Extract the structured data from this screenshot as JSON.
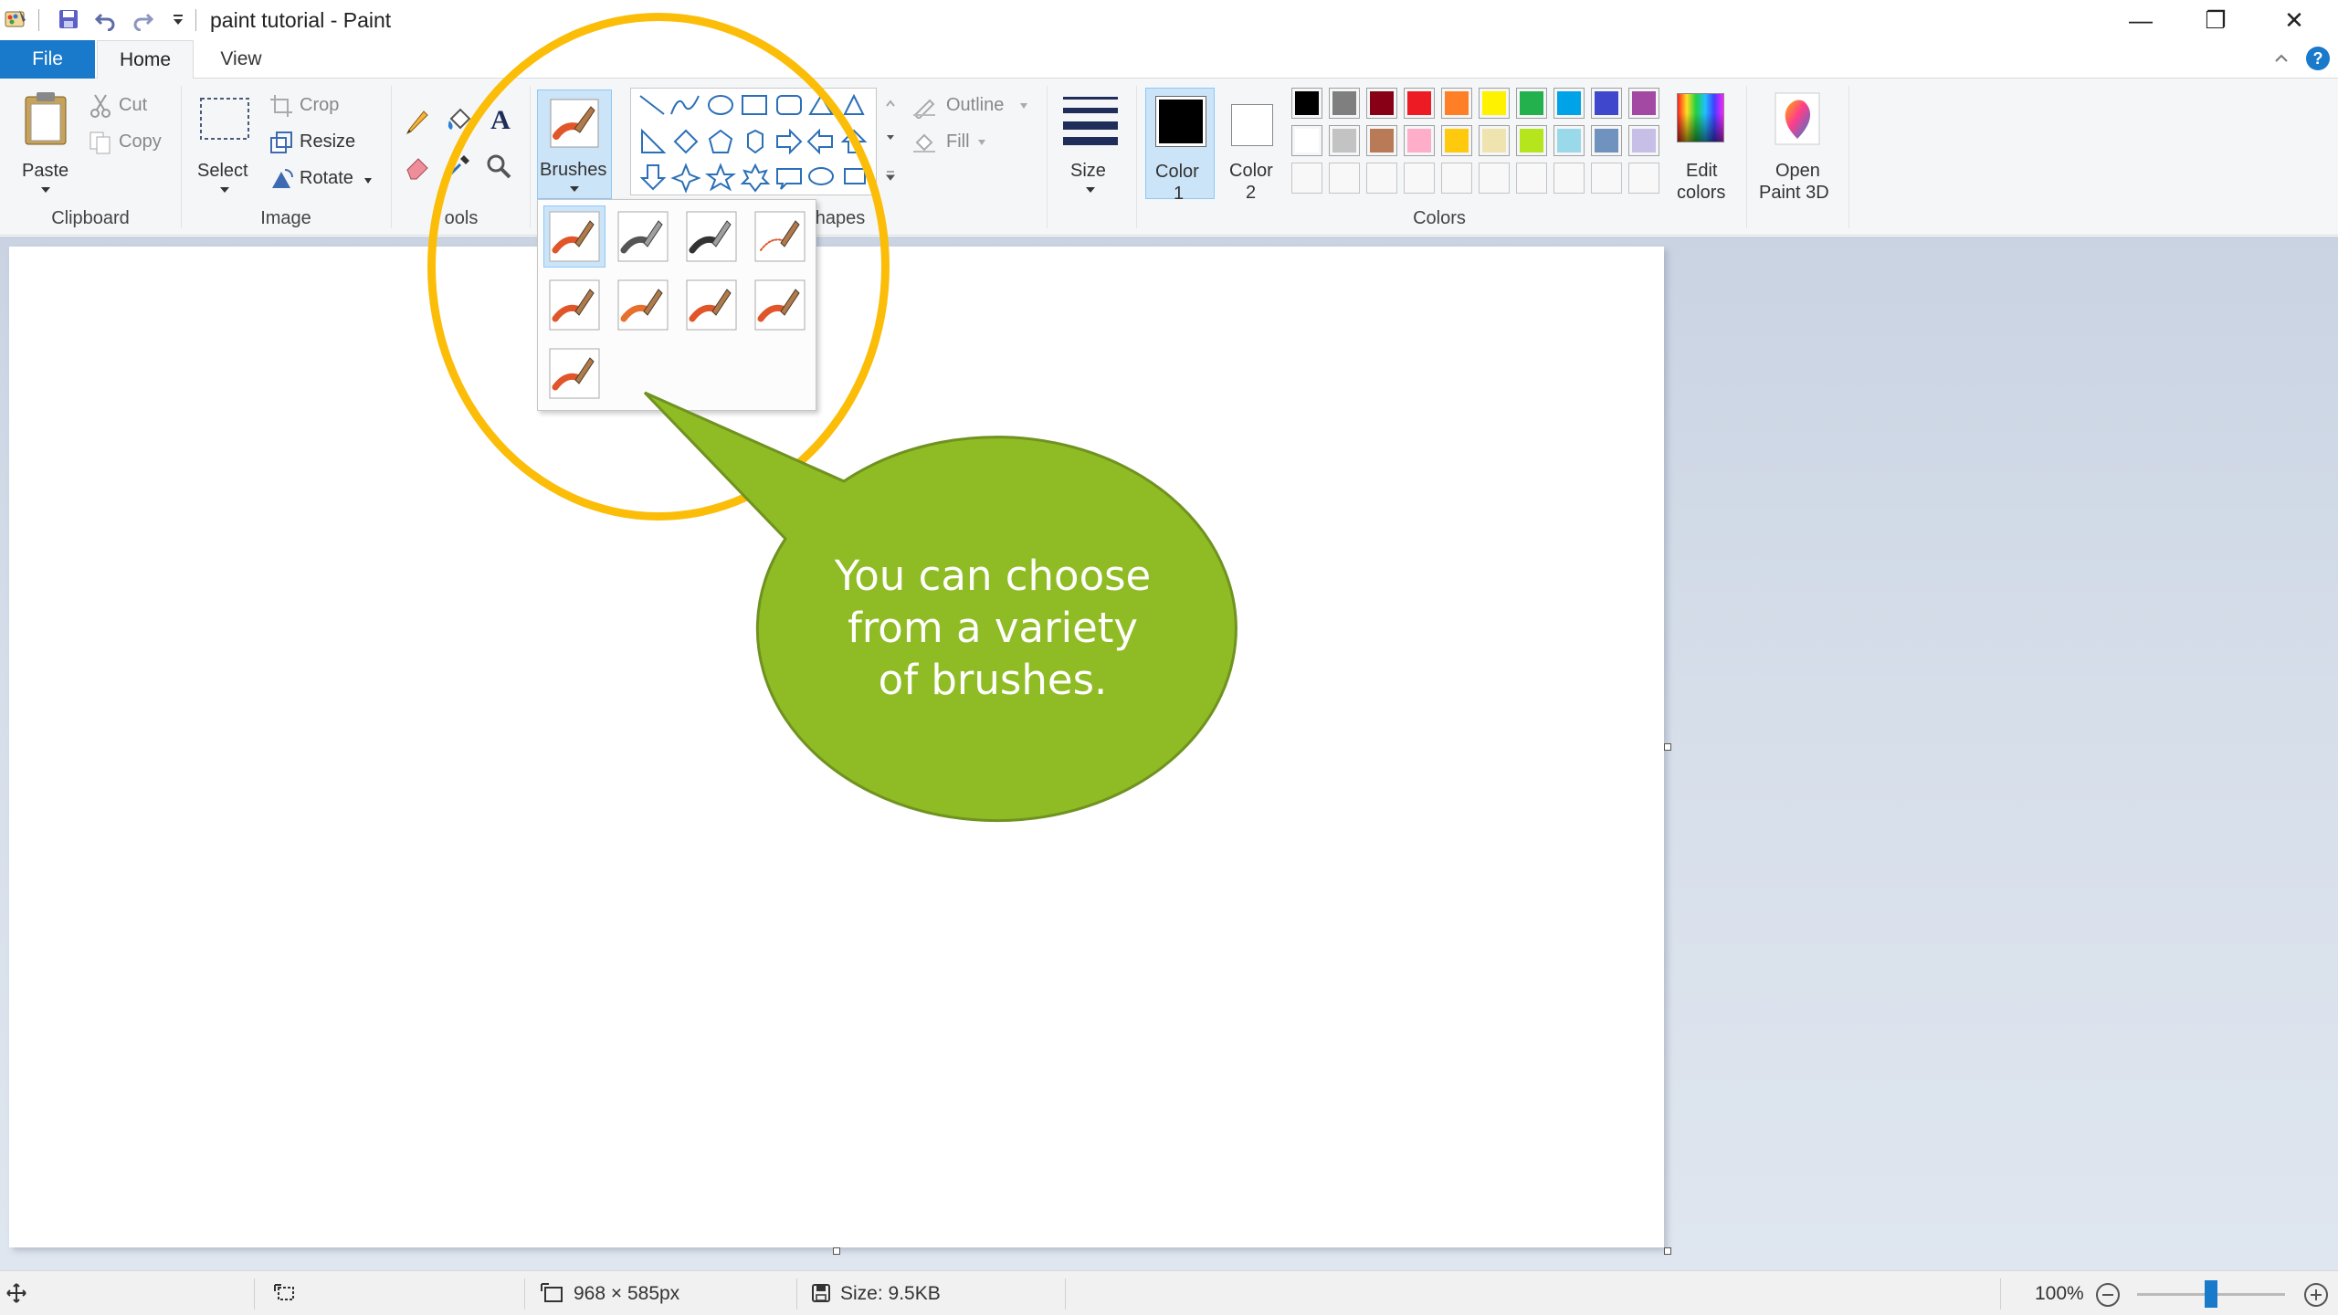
{
  "window": {
    "title": "paint tutorial - Paint",
    "minimize_glyph": "—",
    "restore_glyph": "❐",
    "close_glyph": "✕"
  },
  "tabs": [
    "File",
    "Home",
    "View"
  ],
  "ribbon": {
    "clipboard": {
      "paste": "Paste",
      "cut": "Cut",
      "copy": "Copy",
      "label": "Clipboard"
    },
    "image": {
      "select": "Select",
      "crop": "Crop",
      "resize": "Resize",
      "rotate": "Rotate",
      "label": "Image"
    },
    "tools": {
      "label": "ools"
    },
    "brushes": {
      "label": "Brushes"
    },
    "shapes": {
      "outline": "Outline",
      "fill": "Fill",
      "label": "hapes"
    },
    "size": {
      "label": "Size"
    },
    "colors": {
      "color1_label": "Color",
      "color1_num": "1",
      "color2_label": "Color",
      "color2_num": "2",
      "edit_label": "Edit",
      "edit_label2": "colors",
      "label": "Colors",
      "color1_value": "#000000",
      "color2_value": "#ffffff",
      "palette_row1": [
        "#000000",
        "#7f7f7f",
        "#880015",
        "#ed1c24",
        "#ff7f27",
        "#fff200",
        "#22b14c",
        "#00a2e8",
        "#3f48cc",
        "#a349a4"
      ],
      "palette_row2": [
        "#ffffff",
        "#c3c3c3",
        "#b97a57",
        "#ffaec9",
        "#ffc90e",
        "#efe4b0",
        "#b5e61d",
        "#99d9ea",
        "#7092be",
        "#c8bfe7"
      ]
    },
    "paint3d": {
      "label": "Open",
      "label2": "Paint 3D"
    }
  },
  "brush_dropdown": {
    "items": [
      "brush",
      "calligraphy-brush-1",
      "calligraphy-brush-2",
      "airbrush",
      "oil-brush",
      "crayon",
      "marker",
      "natural-pencil",
      "watercolor-brush"
    ],
    "selected_index": 0
  },
  "callout": {
    "line1": "You can choose",
    "line2": "from a variety",
    "line3": "of brushes.",
    "fill": "#8fbc24",
    "ellipse_color": "#fbbd07"
  },
  "status": {
    "dimensions": "968 × 585px",
    "size": "Size: 9.5KB",
    "zoom": "100%",
    "zoom_level": 0.5
  }
}
